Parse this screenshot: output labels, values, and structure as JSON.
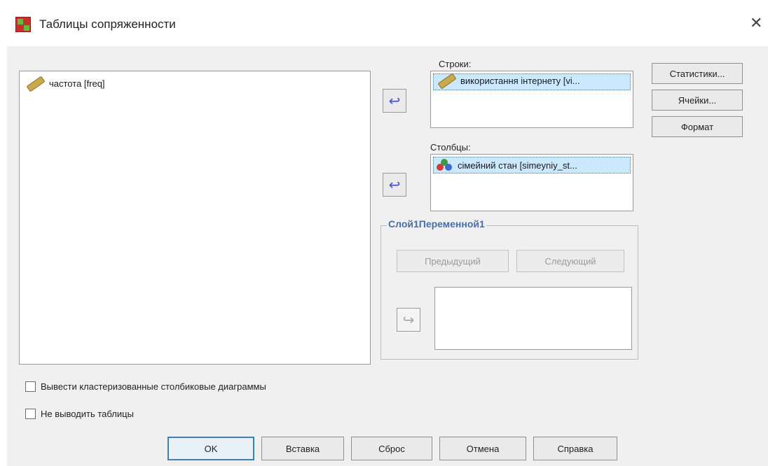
{
  "window": {
    "title": "Таблицы сопряженности"
  },
  "source_list": {
    "items": [
      {
        "label": "частота [freq]",
        "icon": "scale-ruler-icon"
      }
    ]
  },
  "rows": {
    "label": "Строки:",
    "items": [
      {
        "label": "використання інтернету [vi...",
        "icon": "scale-ruler-icon"
      }
    ]
  },
  "columns": {
    "label": "Столбцы:",
    "items": [
      {
        "label": "сімейний стан [simeyniy_st...",
        "icon": "nominal-balls-icon"
      }
    ]
  },
  "layer": {
    "title": "Слой1Переменной1",
    "prev_label": "Предыдущий",
    "next_label": "Следующий"
  },
  "side_buttons": {
    "statistics": "Статистики...",
    "cells": "Ячейки...",
    "format": "Формат"
  },
  "options": {
    "clustered_bars": "Вывести кластеризованные столбиковые диаграммы",
    "suppress_tables": "Не выводить таблицы"
  },
  "footer": {
    "ok": "OK",
    "paste": "Вставка",
    "reset": "Сброс",
    "cancel": "Отмена",
    "help": "Справка"
  },
  "colors": {
    "default_border": "#3c7fb1",
    "arrow": "#4a56c8",
    "group_title": "#4a6ca8"
  }
}
